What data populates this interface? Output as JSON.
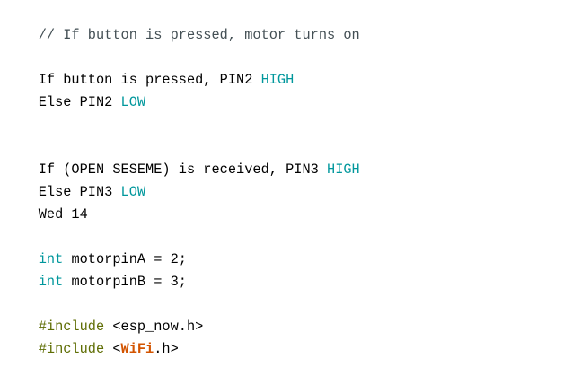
{
  "editor": {
    "lines": [
      {
        "parts": [
          {
            "text": "// If button is pressed, motor turns on",
            "kind": "comment"
          }
        ]
      },
      {
        "parts": []
      },
      {
        "parts": [
          {
            "text": "If button is pressed, PIN2 ",
            "kind": "plain"
          },
          {
            "text": "HIGH",
            "kind": "const"
          }
        ]
      },
      {
        "parts": [
          {
            "text": "Else PIN2 ",
            "kind": "plain"
          },
          {
            "text": "LOW",
            "kind": "const"
          }
        ]
      },
      {
        "parts": []
      },
      {
        "parts": []
      },
      {
        "parts": [
          {
            "text": "If (OPEN SESEME) is received, PIN3 ",
            "kind": "plain"
          },
          {
            "text": "HIGH",
            "kind": "const"
          }
        ]
      },
      {
        "parts": [
          {
            "text": "Else PIN3 ",
            "kind": "plain"
          },
          {
            "text": "LOW",
            "kind": "const"
          }
        ]
      },
      {
        "parts": [
          {
            "text": "Wed 14",
            "kind": "plain"
          }
        ]
      },
      {
        "parts": []
      },
      {
        "parts": [
          {
            "text": "int",
            "kind": "type"
          },
          {
            "text": " motorpinA = 2;",
            "kind": "plain"
          }
        ]
      },
      {
        "parts": [
          {
            "text": "int",
            "kind": "type"
          },
          {
            "text": " motorpinB = 3;",
            "kind": "plain"
          }
        ]
      },
      {
        "parts": []
      },
      {
        "parts": [
          {
            "text": "#include",
            "kind": "preproc"
          },
          {
            "text": " <esp_now.h>",
            "kind": "plain"
          }
        ]
      },
      {
        "parts": [
          {
            "text": "#include",
            "kind": "preproc"
          },
          {
            "text": " <",
            "kind": "plain"
          },
          {
            "text": "WiFi",
            "kind": "lib"
          },
          {
            "text": ".h>",
            "kind": "plain"
          }
        ]
      }
    ]
  },
  "colors": {
    "background": "#ffffff",
    "text": "#000000",
    "comment": "#434f54",
    "constant": "#00979c",
    "type": "#00979c",
    "preprocessor": "#5e6d03",
    "library": "#d35400"
  }
}
